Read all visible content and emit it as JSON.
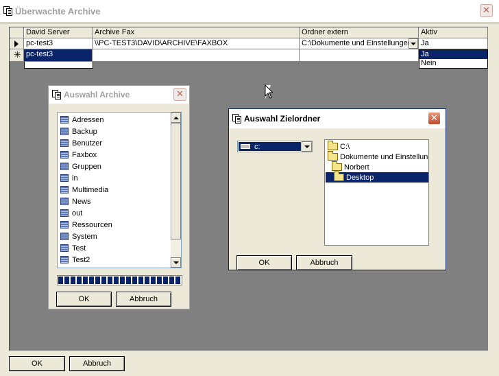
{
  "main_window": {
    "title": "Überwachte Archive",
    "close_glyph": "✕",
    "grid": {
      "columns": [
        "David Server",
        "Archive Fax",
        "Ordner extern",
        "Aktiv"
      ],
      "rows": [
        {
          "david_server": "pc-test3",
          "archive_fax": "\\\\PC-TEST3\\DAVID\\ARCHIVE\\FAXBOX",
          "ordner_extern": "C:\\Dokumente und Einstellungen",
          "aktiv": "Ja"
        },
        {
          "david_server": "pc-test3",
          "archive_fax": "",
          "ordner_extern": "",
          "aktiv": ""
        }
      ],
      "aktiv_options": [
        "Ja",
        "Nein"
      ]
    },
    "ok_label": "OK",
    "cancel_label": "Abbruch"
  },
  "archive_dialog": {
    "title": "Auswahl Archive",
    "close_glyph": "✕",
    "items": [
      "Adressen",
      "Backup",
      "Benutzer",
      "Faxbox",
      "Gruppen",
      "in",
      "Multimedia",
      "News",
      "out",
      "Ressourcen",
      "System",
      "Test",
      "Test2"
    ],
    "ok_label": "OK",
    "cancel_label": "Abbruch"
  },
  "folder_dialog": {
    "title": "Auswahl Zielordner",
    "close_glyph": "✕",
    "drive": "c:",
    "tree": [
      "C:\\",
      "Dokumente und Einstellungen",
      "Norbert",
      "Desktop"
    ],
    "selected": "Desktop",
    "ok_label": "OK",
    "cancel_label": "Abbruch"
  },
  "colors": {
    "selection": "#0a246a",
    "window_bg": "#ece9d8",
    "close_red": "#c24b2b"
  }
}
